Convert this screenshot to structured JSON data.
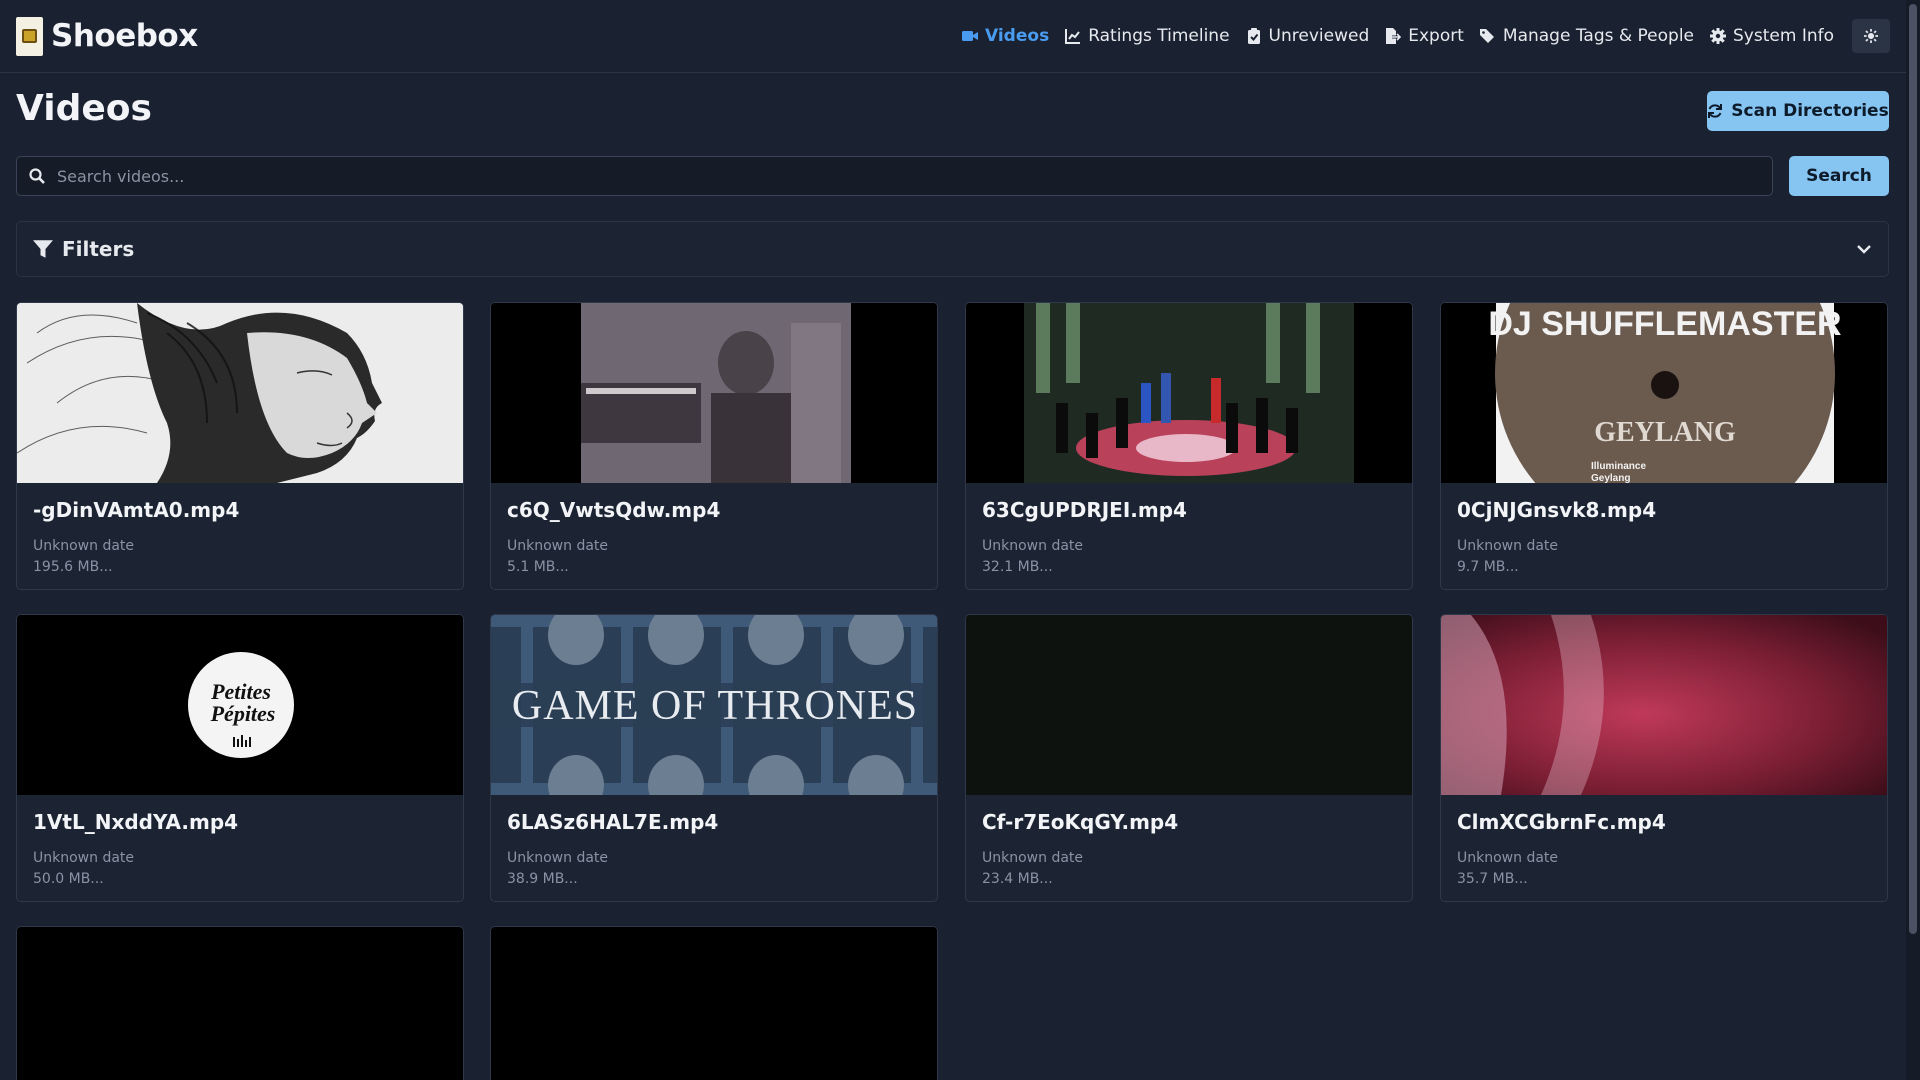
{
  "brand": {
    "name": "Shoebox",
    "logo_icon": "shoebox-logo-icon"
  },
  "nav": [
    {
      "label": "Videos",
      "icon": "video-camera-icon",
      "active": true
    },
    {
      "label": "Ratings Timeline",
      "icon": "line-chart-icon",
      "active": false
    },
    {
      "label": "Unreviewed",
      "icon": "clipboard-check-icon",
      "active": false
    },
    {
      "label": "Export",
      "icon": "file-export-icon",
      "active": false
    },
    {
      "label": "Manage Tags & People",
      "icon": "tags-icon",
      "active": false
    },
    {
      "label": "System Info",
      "icon": "gear-icon",
      "active": false
    }
  ],
  "theme_toggle_icon": "sun-icon",
  "page": {
    "title": "Videos",
    "scan_label": "Scan Directories"
  },
  "search": {
    "placeholder": "Search videos...",
    "value": "",
    "button_label": "Search"
  },
  "filters": {
    "title": "Filters"
  },
  "colors": {
    "accent": "#4a9cf0",
    "button": "#86c4f2",
    "background": "#1a2130"
  },
  "videos": [
    {
      "title": "-gDinVAmtA0.mp4",
      "date": "Unknown date",
      "size": "195.6 MB..."
    },
    {
      "title": "c6Q_VwtsQdw.mp4",
      "date": "Unknown date",
      "size": "5.1 MB..."
    },
    {
      "title": "63CgUPDRJEI.mp4",
      "date": "Unknown date",
      "size": "32.1 MB..."
    },
    {
      "title": "0CjNJGnsvk8.mp4",
      "date": "Unknown date",
      "size": "9.7 MB..."
    },
    {
      "title": "1VtL_NxddYA.mp4",
      "date": "Unknown date",
      "size": "50.0 MB..."
    },
    {
      "title": "6LASz6HAL7E.mp4",
      "date": "Unknown date",
      "size": "38.9 MB..."
    },
    {
      "title": "Cf-r7EoKqGY.mp4",
      "date": "Unknown date",
      "size": "23.4 MB..."
    },
    {
      "title": "ClmXCGbrnFc.mp4",
      "date": "Unknown date",
      "size": "35.7 MB..."
    },
    {
      "title": "",
      "date": "",
      "size": ""
    },
    {
      "title": "",
      "date": "",
      "size": ""
    }
  ],
  "thumb_text": {
    "record_label": "DJ SHUFFLEMASTER",
    "record_title": "GEYLANG",
    "record_tracks": [
      "Illuminance",
      "Geylang"
    ],
    "logo_text": [
      "Petites",
      "Pépites"
    ],
    "show_title": "GAME OF THRONES"
  }
}
